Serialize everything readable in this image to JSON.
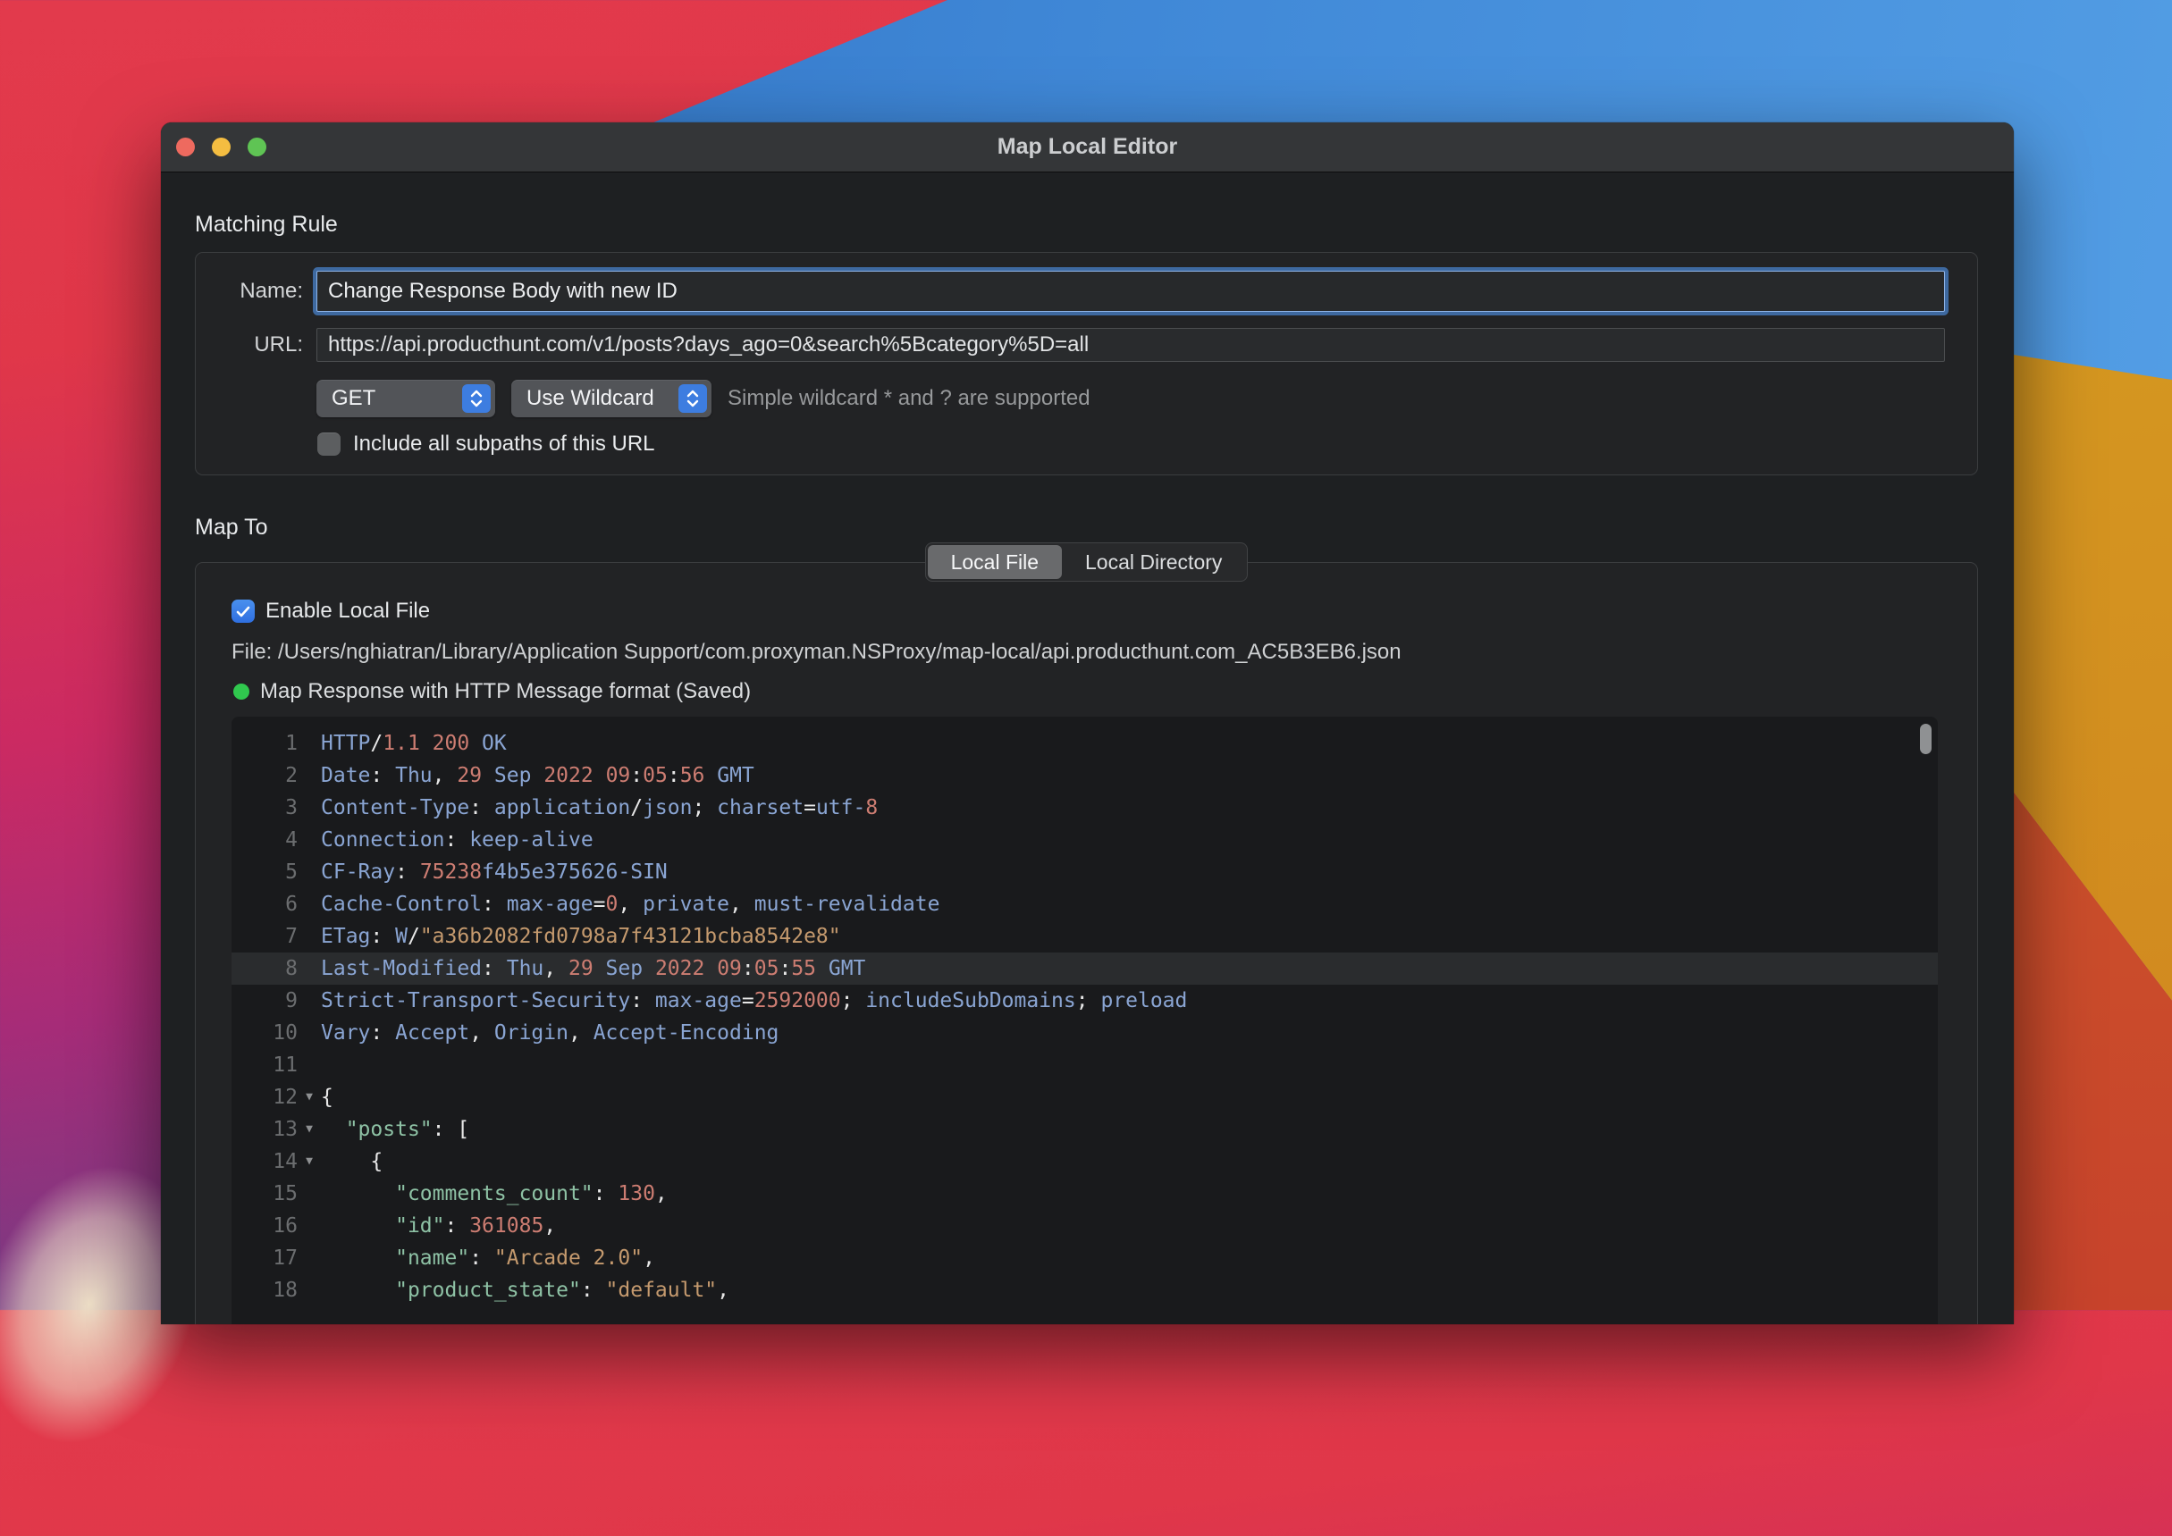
{
  "window": {
    "title": "Map Local Editor"
  },
  "colors": {
    "accent_blue": "#3d7de0",
    "focus_ring": "#3e69a0",
    "status_green": "#30c84e",
    "traffic_red": "#ee6a5f",
    "traffic_yellow": "#f4bd41",
    "traffic_green": "#5fc454"
  },
  "matching_rule": {
    "section_label": "Matching Rule",
    "name_label": "Name:",
    "name_value": "Change Response Body with new ID",
    "url_label": "URL:",
    "url_value": "https://api.producthunt.com/v1/posts?days_ago=0&search%5Bcategory%5D=all",
    "method_select": "GET",
    "wildcard_select": "Use Wildcard",
    "wildcard_hint": "Simple wildcard * and ? are supported",
    "subpaths_checkbox_label": "Include all subpaths of this URL",
    "subpaths_checked": false
  },
  "map_to": {
    "section_label": "Map To",
    "tabs": [
      {
        "label": "Local File",
        "selected": true
      },
      {
        "label": "Local Directory",
        "selected": false
      }
    ],
    "enable_checkbox_label": "Enable Local File",
    "enable_checked": true,
    "file_label": "File:",
    "file_path": " /Users/nghiatran/Library/Application Support/com.proxyman.NSProxy/map-local/api.producthunt.com_AC5B3EB6.json",
    "status_text": "Map Response with HTTP Message format (Saved)"
  },
  "editor": {
    "lines": [
      {
        "n": 1,
        "tokens": [
          [
            "HTTP",
            "h"
          ],
          [
            "/",
            "p"
          ],
          [
            "1.1 200",
            "n"
          ],
          [
            " OK",
            "h"
          ]
        ]
      },
      {
        "n": 2,
        "tokens": [
          [
            "Date",
            "h"
          ],
          [
            ":",
            "p"
          ],
          [
            " Thu",
            "h"
          ],
          [
            ",",
            "p"
          ],
          [
            " ",
            ""
          ],
          [
            "29",
            "n"
          ],
          [
            " ",
            ""
          ],
          [
            "Sep",
            "h"
          ],
          [
            " ",
            ""
          ],
          [
            "2022 09",
            "n"
          ],
          [
            ":",
            "p"
          ],
          [
            "05",
            "n"
          ],
          [
            ":",
            "p"
          ],
          [
            "56",
            "n"
          ],
          [
            " GMT",
            "h"
          ]
        ]
      },
      {
        "n": 3,
        "tokens": [
          [
            "Content-Type",
            "h"
          ],
          [
            ":",
            "p"
          ],
          [
            " application",
            "h"
          ],
          [
            "/",
            "p"
          ],
          [
            "json",
            "h"
          ],
          [
            ";",
            "p"
          ],
          [
            " charset",
            "h"
          ],
          [
            "=",
            "p"
          ],
          [
            "utf-",
            "h"
          ],
          [
            "8",
            "n"
          ]
        ]
      },
      {
        "n": 4,
        "tokens": [
          [
            "Connection",
            "h"
          ],
          [
            ":",
            "p"
          ],
          [
            " keep-alive",
            "h"
          ]
        ]
      },
      {
        "n": 5,
        "tokens": [
          [
            "CF-Ray",
            "h"
          ],
          [
            ":",
            "p"
          ],
          [
            " ",
            ""
          ],
          [
            "75238",
            "n"
          ],
          [
            "f4b5e375626-SIN",
            "h"
          ]
        ]
      },
      {
        "n": 6,
        "tokens": [
          [
            "Cache-Control",
            "h"
          ],
          [
            ":",
            "p"
          ],
          [
            " max-age",
            "h"
          ],
          [
            "=",
            "p"
          ],
          [
            "0",
            "n"
          ],
          [
            ",",
            "p"
          ],
          [
            " private",
            "h"
          ],
          [
            ",",
            "p"
          ],
          [
            " must-revalidate",
            "h"
          ]
        ]
      },
      {
        "n": 7,
        "tokens": [
          [
            "ETag",
            "h"
          ],
          [
            ":",
            "p"
          ],
          [
            " W",
            "h"
          ],
          [
            "/",
            "p"
          ],
          [
            "\"a36b2082fd0798a7f43121bcba8542e8\"",
            "s"
          ]
        ]
      },
      {
        "n": 8,
        "hl": true,
        "tokens": [
          [
            "Last-Modified",
            "h"
          ],
          [
            ":",
            "p"
          ],
          [
            " Thu",
            "h"
          ],
          [
            ",",
            "p"
          ],
          [
            " ",
            ""
          ],
          [
            "29",
            "n"
          ],
          [
            " ",
            ""
          ],
          [
            "Sep",
            "h"
          ],
          [
            " ",
            ""
          ],
          [
            "2022 09",
            "n"
          ],
          [
            ":",
            "p"
          ],
          [
            "05",
            "n"
          ],
          [
            ":",
            "p"
          ],
          [
            "55",
            "n"
          ],
          [
            " GMT",
            "h"
          ]
        ]
      },
      {
        "n": 9,
        "tokens": [
          [
            "Strict-Transport-Security",
            "h"
          ],
          [
            ":",
            "p"
          ],
          [
            " max-age",
            "h"
          ],
          [
            "=",
            "p"
          ],
          [
            "2592000",
            "n"
          ],
          [
            ";",
            "p"
          ],
          [
            " includeSubDomains",
            "h"
          ],
          [
            ";",
            "p"
          ],
          [
            " preload",
            "h"
          ]
        ]
      },
      {
        "n": 10,
        "tokens": [
          [
            "Vary",
            "h"
          ],
          [
            ":",
            "p"
          ],
          [
            " Accept",
            "h"
          ],
          [
            ",",
            "p"
          ],
          [
            " Origin",
            "h"
          ],
          [
            ",",
            "p"
          ],
          [
            " Accept-Encoding",
            "h"
          ]
        ]
      },
      {
        "n": 11,
        "tokens": []
      },
      {
        "n": 12,
        "fold": true,
        "tokens": [
          [
            "{",
            "p"
          ]
        ]
      },
      {
        "n": 13,
        "fold": true,
        "tokens": [
          [
            "  ",
            ""
          ],
          [
            "\"posts\"",
            "k"
          ],
          [
            ":",
            "p"
          ],
          [
            " [",
            "p"
          ]
        ]
      },
      {
        "n": 14,
        "fold": true,
        "tokens": [
          [
            "    {",
            "p"
          ]
        ]
      },
      {
        "n": 15,
        "tokens": [
          [
            "      ",
            ""
          ],
          [
            "\"comments_count\"",
            "k"
          ],
          [
            ":",
            "p"
          ],
          [
            " ",
            ""
          ],
          [
            "130",
            "n"
          ],
          [
            ",",
            "p"
          ]
        ]
      },
      {
        "n": 16,
        "tokens": [
          [
            "      ",
            ""
          ],
          [
            "\"id\"",
            "k"
          ],
          [
            ":",
            "p"
          ],
          [
            " ",
            ""
          ],
          [
            "361085",
            "n"
          ],
          [
            ",",
            "p"
          ]
        ]
      },
      {
        "n": 17,
        "tokens": [
          [
            "      ",
            ""
          ],
          [
            "\"name\"",
            "k"
          ],
          [
            ":",
            "p"
          ],
          [
            " ",
            ""
          ],
          [
            "\"Arcade 2.0\"",
            "s"
          ],
          [
            ",",
            "p"
          ]
        ]
      },
      {
        "n": 18,
        "tokens": [
          [
            "      ",
            ""
          ],
          [
            "\"product_state\"",
            "k"
          ],
          [
            ":",
            "p"
          ],
          [
            " ",
            ""
          ],
          [
            "\"default\"",
            "s"
          ],
          [
            ",",
            "p"
          ]
        ]
      }
    ]
  }
}
